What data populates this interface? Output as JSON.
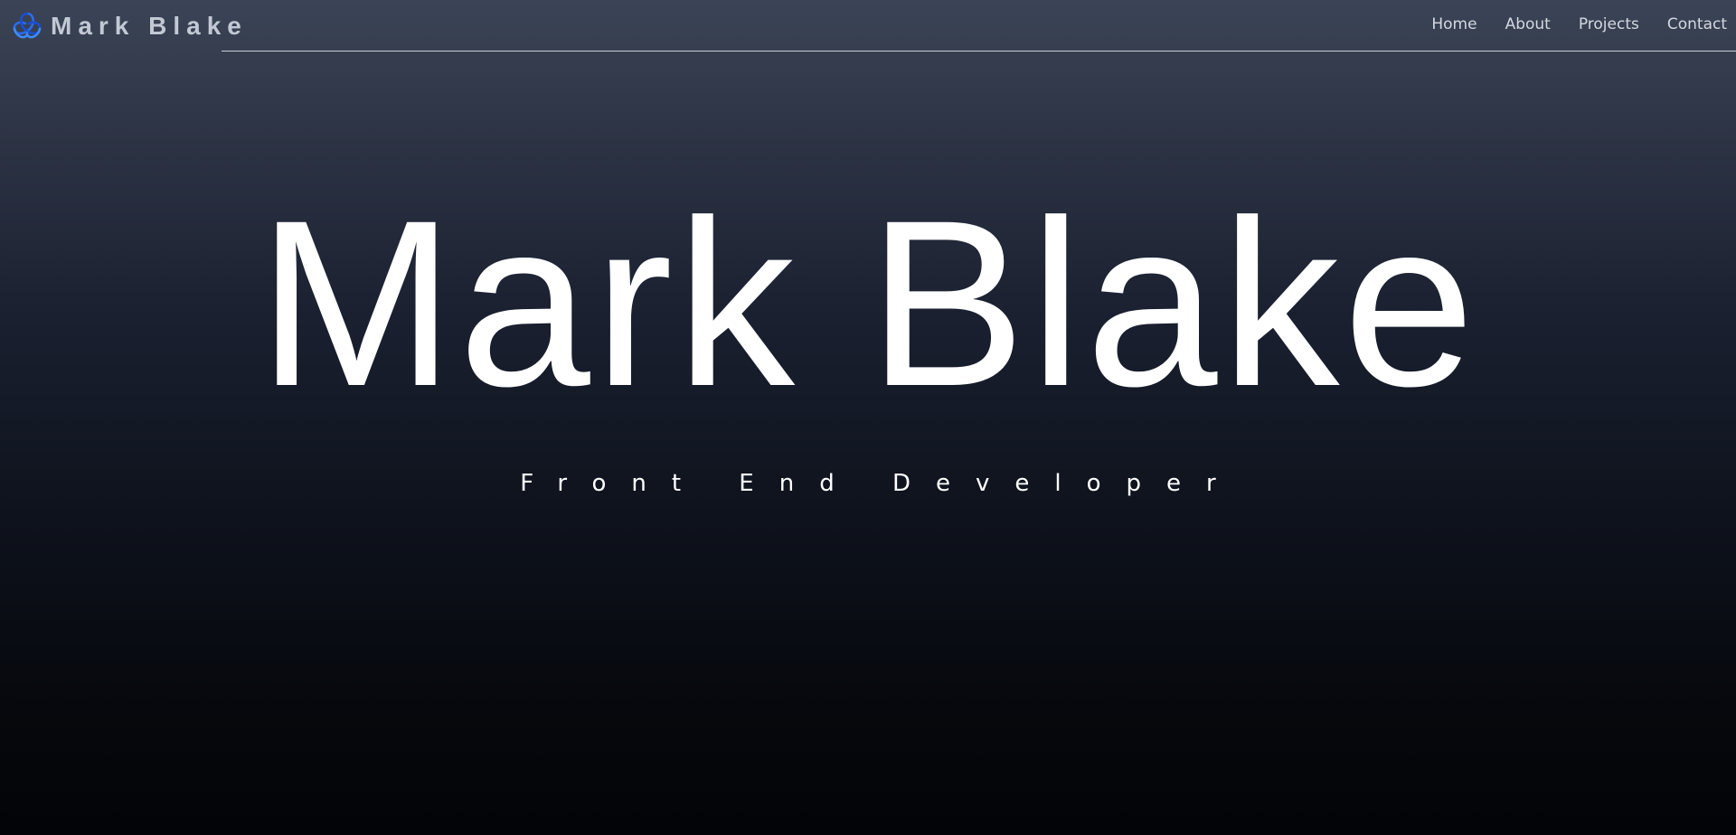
{
  "brand": {
    "name": "Mark Blake",
    "icon": "trefoil-knot-icon",
    "icon_colors": [
      "#1d6fe8",
      "#2a4bd8",
      "#4fa3ff"
    ]
  },
  "nav": {
    "items": [
      {
        "label": "Home"
      },
      {
        "label": "About"
      },
      {
        "label": "Projects"
      },
      {
        "label": "Contact"
      }
    ]
  },
  "hero": {
    "title": "Mark Blake",
    "subtitle": "Front End Developer"
  },
  "colors": {
    "background_top": "#3b4456",
    "background_bottom": "#030407",
    "text": "#ffffff",
    "nav_text": "#d4d8e0",
    "brand_text": "#c2c8d4"
  }
}
